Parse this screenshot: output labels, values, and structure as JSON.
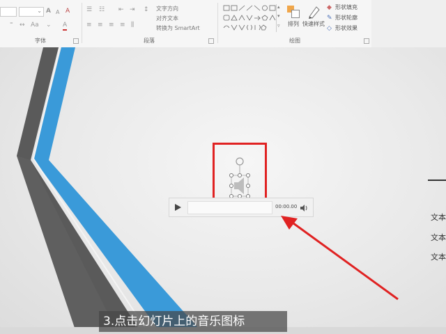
{
  "ribbon": {
    "groups": {
      "font": "字体",
      "paragraph": "段落",
      "drawing": "绘图"
    },
    "paragraph_controls": {
      "text_direction": "文字方向",
      "align_text": "对齐文本",
      "convert_smartart": "转换为 SmartArt"
    },
    "drawing_controls": {
      "arrange": "排列",
      "quick_styles": "快速样式",
      "shape_fill": "形状填充",
      "shape_outline": "形状轮廓",
      "shape_effects": "形状效果"
    },
    "font_buttons": {
      "grow": "A",
      "shrink": "A",
      "clear": "A",
      "font_color": "A"
    }
  },
  "media_player": {
    "time": "00:00.00"
  },
  "slide_text": {
    "line1": "文本",
    "line2": "文本",
    "line3": "文本"
  },
  "caption": "3.点击幻灯片上的音乐图标",
  "colors": {
    "highlight": "#e02222",
    "accent_blue": "#3a9ad9",
    "stripe_gray": "#5a5a5a"
  }
}
